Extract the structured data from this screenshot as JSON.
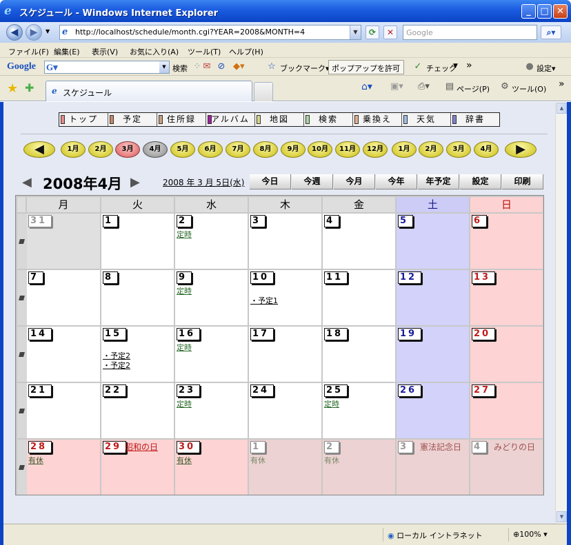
{
  "window": {
    "title": "スケジュール - Windows Internet Explorer"
  },
  "address": {
    "url": "http://localhost/schedule/month.cgi?YEAR=2008&MONTH=4"
  },
  "search": {
    "placeholder": "Google"
  },
  "menu": [
    "ファイル(F)",
    "編集(E)",
    "表示(V)",
    "お気に入り(A)",
    "ツール(T)",
    "ヘルプ(H)"
  ],
  "google_bar": {
    "logo": "Google",
    "search_label": "検索",
    "bookmark": "ブックマーク▾",
    "popup": "ポップアップを許可",
    "check": "チェック",
    "settings": "設定▾"
  },
  "tab": {
    "label": "スケジュール"
  },
  "cmdbar": {
    "page": "ページ(P)",
    "tools": "ツール(O)"
  },
  "status": {
    "zone": "ローカル イントラネット",
    "zoom": "100%"
  },
  "site_nav": [
    {
      "label": "トップ",
      "color": "#e58a8a"
    },
    {
      "label": "予定",
      "color": "#c88868"
    },
    {
      "label": "住所録",
      "color": "#c8a080"
    },
    {
      "label": "アルバム",
      "color": "#a020a0"
    },
    {
      "label": "地図",
      "color": "#d8d890"
    },
    {
      "label": "検索",
      "color": "#a8d8a0"
    },
    {
      "label": "乗換え",
      "color": "#e0b090"
    },
    {
      "label": "天気",
      "color": "#a0c0e8"
    },
    {
      "label": "辞書",
      "color": "#8080d0"
    }
  ],
  "months": [
    "1月",
    "2月",
    "3月",
    "4月",
    "5月",
    "6月",
    "7月",
    "8月",
    "9月",
    "10月",
    "11月",
    "12月",
    "1月",
    "2月",
    "3月",
    "4月"
  ],
  "calendar": {
    "title": "2008年4月",
    "today_link": "2008 年 3 月 5日(水)",
    "actions": [
      "今日",
      "今週",
      "今月",
      "今年",
      "年予定",
      "設定",
      "印刷"
    ],
    "weekdays": [
      "月",
      "火",
      "水",
      "木",
      "金",
      "土",
      "日"
    ],
    "weeks": [
      [
        {
          "d": "31",
          "t": "prev"
        },
        {
          "d": "1"
        },
        {
          "d": "2",
          "ev": [
            "定時"
          ]
        },
        {
          "d": "3"
        },
        {
          "d": "4"
        },
        {
          "d": "5",
          "t": "sat"
        },
        {
          "d": "6",
          "t": "sun"
        }
      ],
      [
        {
          "d": "7"
        },
        {
          "d": "8"
        },
        {
          "d": "9",
          "ev": [
            "定時"
          ]
        },
        {
          "d": "10",
          "ev": [
            "・予定1"
          ]
        },
        {
          "d": "11"
        },
        {
          "d": "12",
          "t": "sat"
        },
        {
          "d": "13",
          "t": "sun"
        }
      ],
      [
        {
          "d": "14"
        },
        {
          "d": "15",
          "ev": [
            "・予定2",
            "・予定2"
          ]
        },
        {
          "d": "16",
          "ev": [
            "定時"
          ]
        },
        {
          "d": "17"
        },
        {
          "d": "18"
        },
        {
          "d": "19",
          "t": "sat"
        },
        {
          "d": "20",
          "t": "sun"
        }
      ],
      [
        {
          "d": "21"
        },
        {
          "d": "22"
        },
        {
          "d": "23",
          "ev": [
            "定時"
          ]
        },
        {
          "d": "24"
        },
        {
          "d": "25",
          "ev": [
            "定時"
          ]
        },
        {
          "d": "26",
          "t": "sat"
        },
        {
          "d": "27",
          "t": "sun"
        }
      ],
      [
        {
          "d": "28",
          "t": "hol",
          "ev": [
            "有休"
          ]
        },
        {
          "d": "29",
          "t": "hol",
          "hname": "昭和の日"
        },
        {
          "d": "30",
          "t": "hol",
          "ev": [
            "有休"
          ]
        },
        {
          "d": "1",
          "t": "next",
          "ev": [
            "有休"
          ]
        },
        {
          "d": "2",
          "t": "next",
          "ev": [
            "有休"
          ]
        },
        {
          "d": "3",
          "t": "next",
          "hname": "憲法記念日"
        },
        {
          "d": "4",
          "t": "next",
          "hname": "みどりの日"
        }
      ]
    ]
  }
}
